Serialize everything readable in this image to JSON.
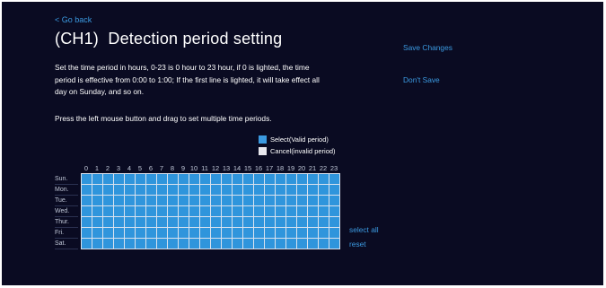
{
  "nav": {
    "go_back": "< Go back"
  },
  "page": {
    "title": "(CH1)  Detection period setting",
    "description": "Set the time period in hours, 0-23 is 0 hour to 23 hour, if 0 is lighted, the time period is effective from 0:00 to 1:00; If the first line is lighted, it will take effect all day on Sunday, and so on.",
    "hint": "Press the left mouse button and drag to set multiple time periods."
  },
  "actions": {
    "save_changes": "Save Changes",
    "dont_save": "Don't Save",
    "select_all": "select all",
    "reset": "reset"
  },
  "legend": {
    "valid": "Select(Valid period)",
    "invalid": "Cancel(invalid period)"
  },
  "schedule": {
    "hours": [
      "0",
      "1",
      "2",
      "3",
      "4",
      "5",
      "6",
      "7",
      "8",
      "9",
      "10",
      "11",
      "12",
      "13",
      "14",
      "15",
      "16",
      "17",
      "18",
      "19",
      "20",
      "21",
      "22",
      "23"
    ],
    "days": [
      "Sun.",
      "Mon.",
      "Tue.",
      "Wed.",
      "Thur.",
      "Fri.",
      "Sat."
    ],
    "selected": [
      [
        true,
        true,
        true,
        true,
        true,
        true,
        true,
        true,
        true,
        true,
        true,
        true,
        true,
        true,
        true,
        true,
        true,
        true,
        true,
        true,
        true,
        true,
        true,
        true
      ],
      [
        true,
        true,
        true,
        true,
        true,
        true,
        true,
        true,
        true,
        true,
        true,
        true,
        true,
        true,
        true,
        true,
        true,
        true,
        true,
        true,
        true,
        true,
        true,
        true
      ],
      [
        true,
        true,
        true,
        true,
        true,
        true,
        true,
        true,
        true,
        true,
        true,
        true,
        true,
        true,
        true,
        true,
        true,
        true,
        true,
        true,
        true,
        true,
        true,
        true
      ],
      [
        true,
        true,
        true,
        true,
        true,
        true,
        true,
        true,
        true,
        true,
        true,
        true,
        true,
        true,
        true,
        true,
        true,
        true,
        true,
        true,
        true,
        true,
        true,
        true
      ],
      [
        true,
        true,
        true,
        true,
        true,
        true,
        true,
        true,
        true,
        true,
        true,
        true,
        true,
        true,
        true,
        true,
        true,
        true,
        true,
        true,
        true,
        true,
        true,
        true
      ],
      [
        true,
        true,
        true,
        true,
        true,
        true,
        true,
        true,
        true,
        true,
        true,
        true,
        true,
        true,
        true,
        true,
        true,
        true,
        true,
        true,
        true,
        true,
        true,
        true
      ],
      [
        true,
        true,
        true,
        true,
        true,
        true,
        true,
        true,
        true,
        true,
        true,
        true,
        true,
        true,
        true,
        true,
        true,
        true,
        true,
        true,
        true,
        true,
        true,
        true
      ]
    ]
  },
  "colors": {
    "background": "#0a0b22",
    "accent": "#3b9ae1",
    "valid": "#2f95dc",
    "invalid": "#e8e8ee"
  }
}
